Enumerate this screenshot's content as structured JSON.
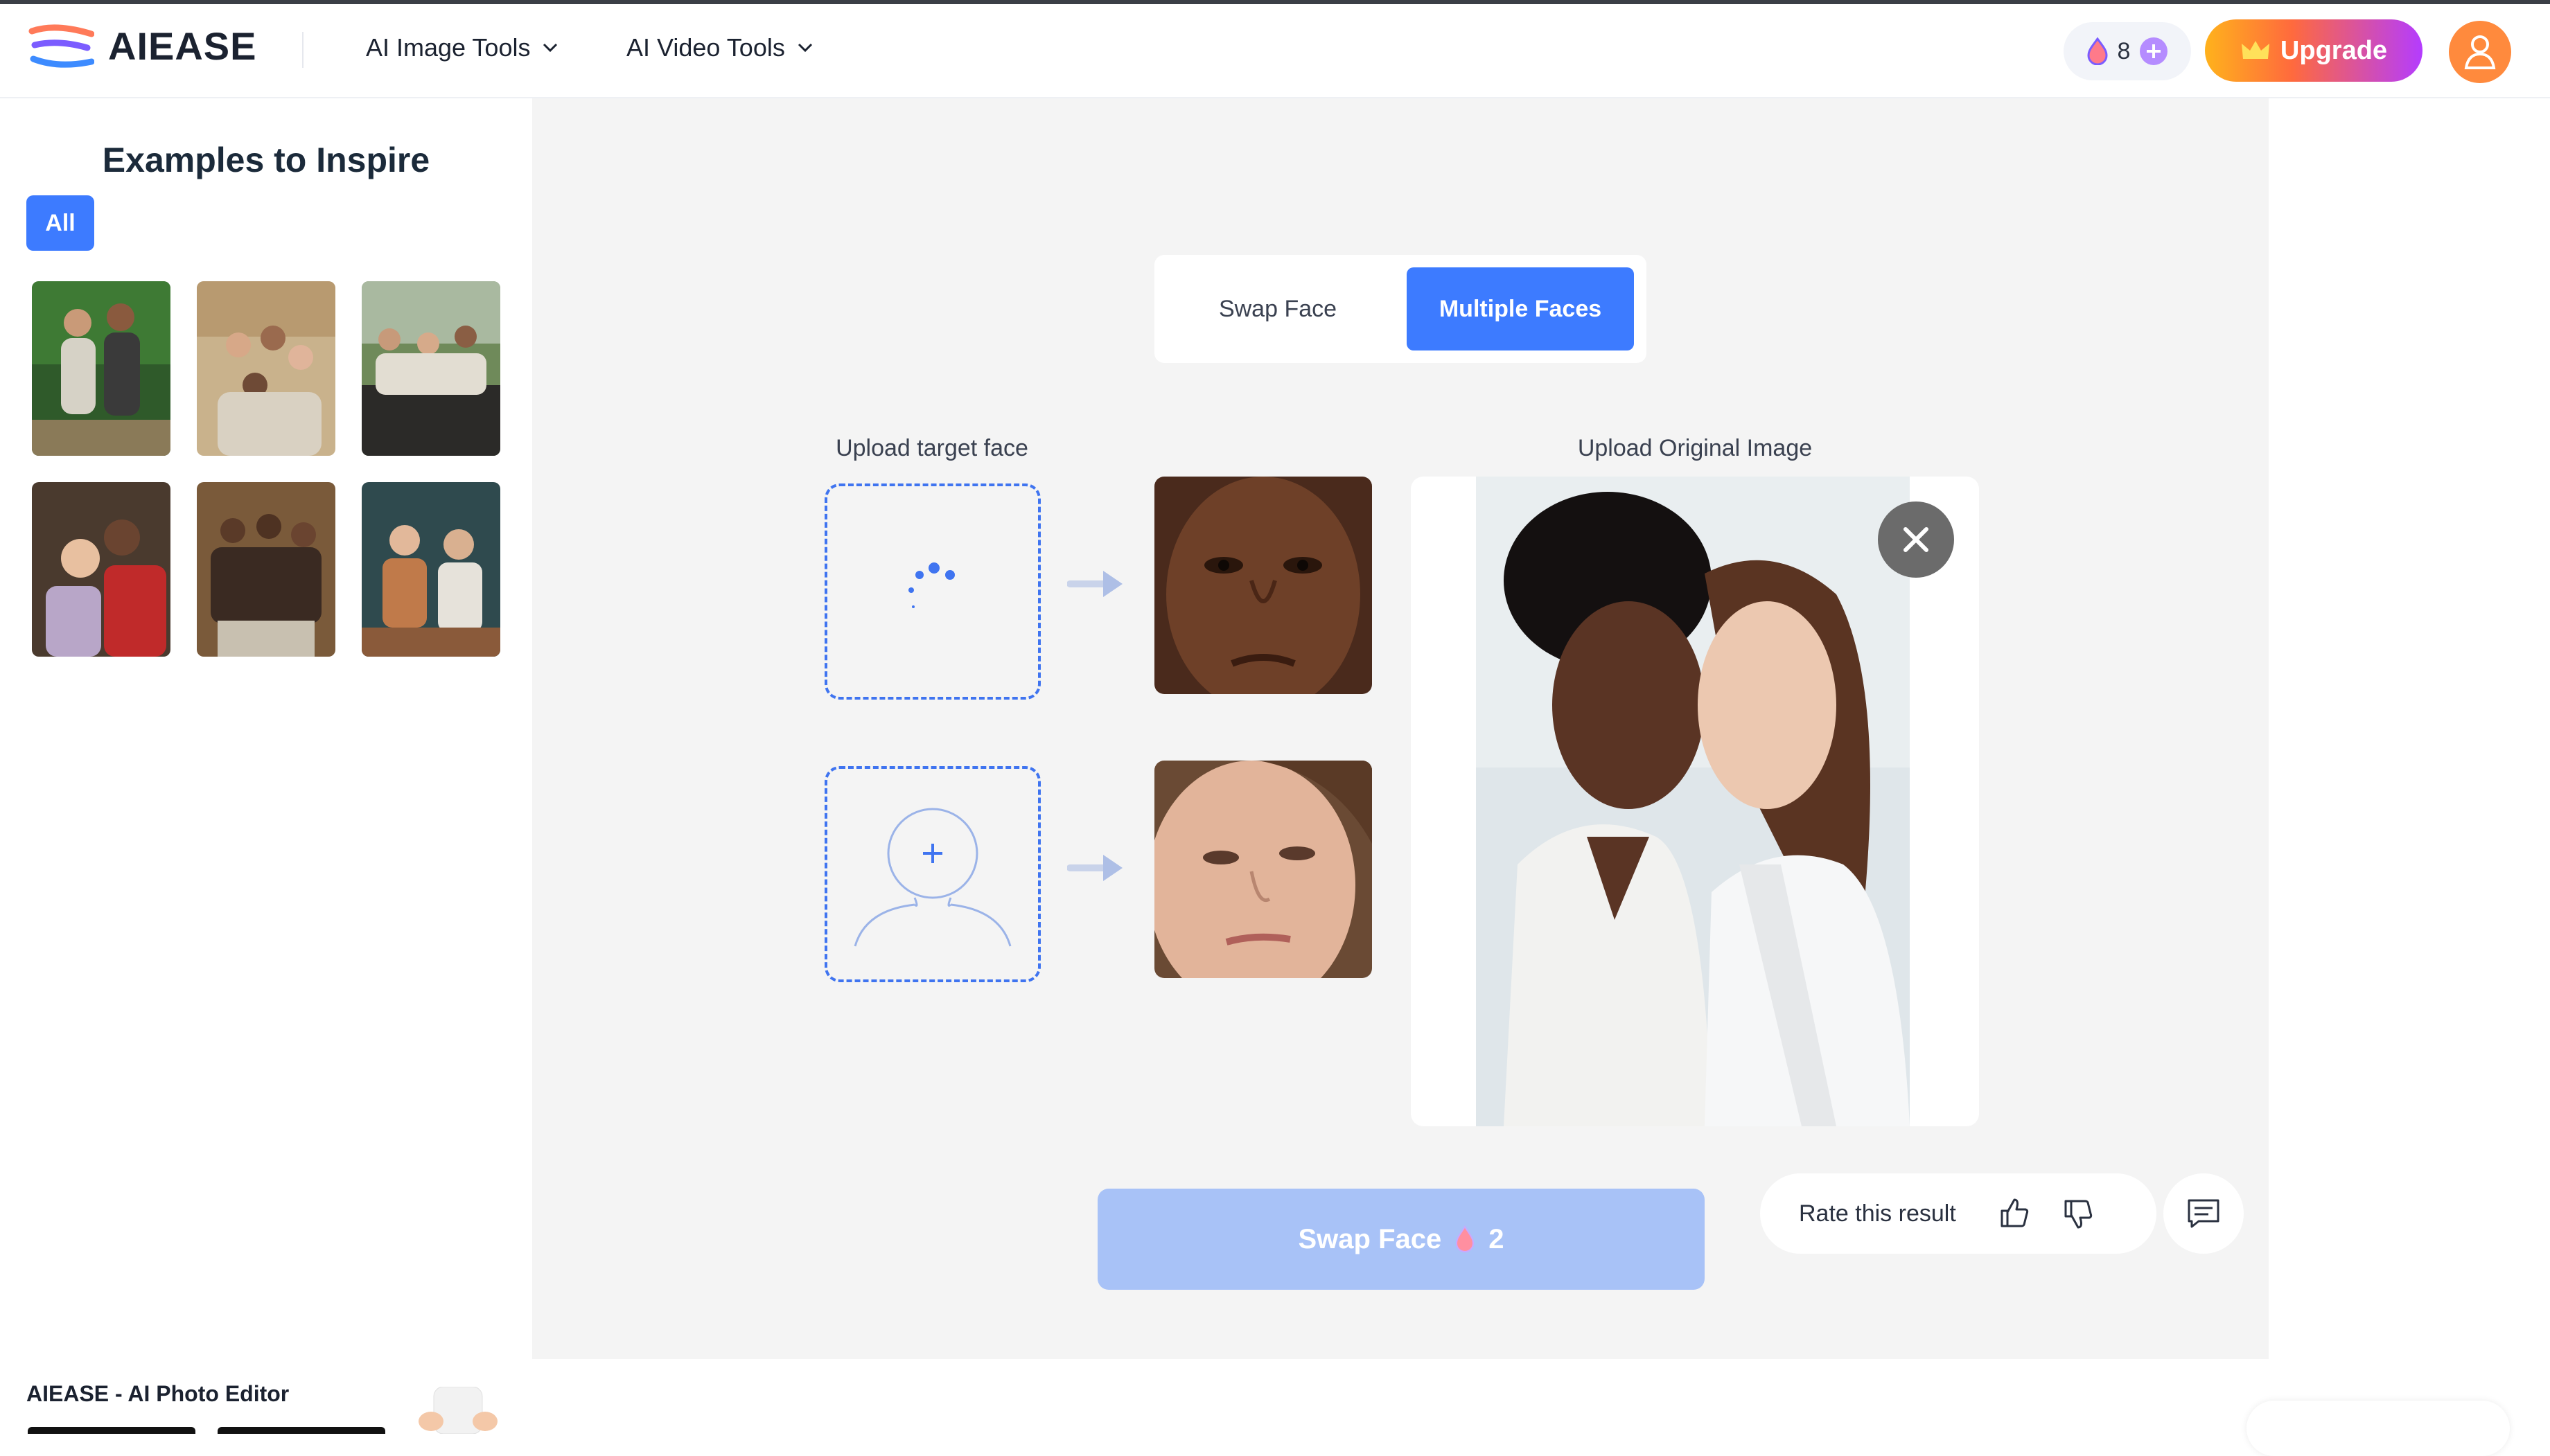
{
  "brand": {
    "name": "AIEASE"
  },
  "nav": [
    {
      "label": "AI Image Tools"
    },
    {
      "label": "AI Video Tools"
    }
  ],
  "credits": {
    "count": "8"
  },
  "upgrade": {
    "label": "Upgrade"
  },
  "sidebar": {
    "title": "Examples to Inspire",
    "filter": "All",
    "footer": "AIEASE - AI Photo Editor"
  },
  "tabs": [
    {
      "label": "Swap Face",
      "active": false
    },
    {
      "label": "Multiple Faces",
      "active": true
    }
  ],
  "upload_target_label": "Upload target face",
  "upload_original_label": "Upload Original Image",
  "swap_button": {
    "label": "Swap Face",
    "cost": "2"
  },
  "rating": {
    "label": "Rate this result"
  },
  "colors": {
    "accent": "#3d7bff",
    "swap_button": "#a8c2f7",
    "upgrade_start": "#ffb21c",
    "upgrade_end": "#b43cff"
  }
}
